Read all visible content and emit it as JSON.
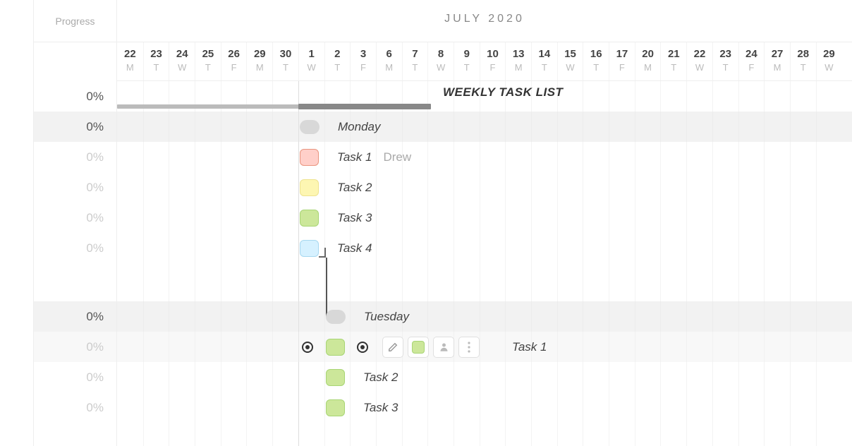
{
  "header": {
    "progress_label": "Progress",
    "month": "JULY 2020"
  },
  "days": [
    {
      "n": "22",
      "w": "M"
    },
    {
      "n": "23",
      "w": "T"
    },
    {
      "n": "24",
      "w": "W"
    },
    {
      "n": "25",
      "w": "T"
    },
    {
      "n": "26",
      "w": "F"
    },
    {
      "n": "29",
      "w": "M"
    },
    {
      "n": "30",
      "w": "T"
    },
    {
      "n": "1",
      "w": "W"
    },
    {
      "n": "2",
      "w": "T"
    },
    {
      "n": "3",
      "w": "F"
    },
    {
      "n": "6",
      "w": "M"
    },
    {
      "n": "7",
      "w": "T"
    },
    {
      "n": "8",
      "w": "W"
    },
    {
      "n": "9",
      "w": "T"
    },
    {
      "n": "10",
      "w": "F"
    },
    {
      "n": "13",
      "w": "M"
    },
    {
      "n": "14",
      "w": "T"
    },
    {
      "n": "15",
      "w": "W"
    },
    {
      "n": "16",
      "w": "T"
    },
    {
      "n": "17",
      "w": "F"
    },
    {
      "n": "20",
      "w": "M"
    },
    {
      "n": "21",
      "w": "T"
    },
    {
      "n": "22",
      "w": "W"
    },
    {
      "n": "23",
      "w": "T"
    },
    {
      "n": "24",
      "w": "F"
    },
    {
      "n": "27",
      "w": "M"
    },
    {
      "n": "28",
      "w": "T"
    },
    {
      "n": "29",
      "w": "W"
    }
  ],
  "progress": {
    "r0": "0%",
    "r1": "0%",
    "r2": "0%",
    "r3": "0%",
    "r4": "0%",
    "r5": "0%",
    "r6": "0%",
    "r7": "0%",
    "r8": "0%",
    "r9": "0%"
  },
  "rows": {
    "summary": "WEEKLY TASK LIST",
    "monday": "Monday",
    "task1": "Task 1",
    "task2": "Task 2",
    "task3": "Task 3",
    "task4": "Task 4",
    "assignee1": "Drew",
    "tuesday": "Tuesday",
    "t_task1": "Task 1",
    "t_task2": "Task 2",
    "t_task3": "Task 3"
  }
}
